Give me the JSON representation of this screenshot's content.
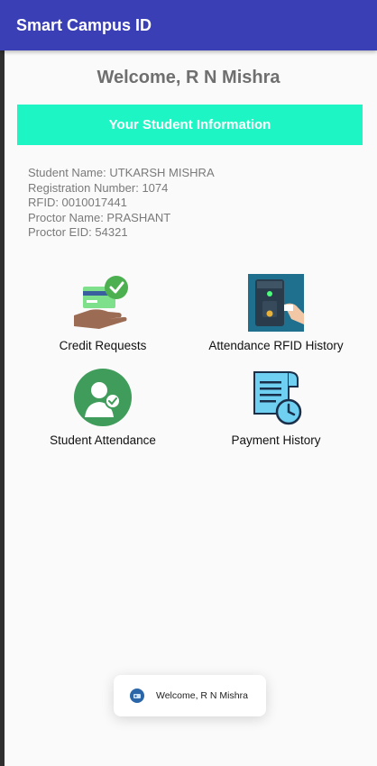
{
  "app": {
    "title": "Smart Campus ID"
  },
  "welcome": "Welcome, R N Mishra",
  "info_banner": "Your Student Information",
  "student": {
    "name_line": "Student Name: UTKARSH MISHRA",
    "registration_line": "Registration Number: 1074",
    "rfid_line": "RFID: 0010017441",
    "proctor_line": "Proctor Name: PRASHANT",
    "proctor_eid_line": "Proctor EID: 54321"
  },
  "tiles": [
    {
      "label": "Credit Requests",
      "icon": "credit-card-check-icon"
    },
    {
      "label": "Attendance RFID History",
      "icon": "rfid-reader-icon"
    },
    {
      "label": "Student Attendance",
      "icon": "student-check-icon"
    },
    {
      "label": "Payment History",
      "icon": "receipt-clock-icon"
    }
  ],
  "toast": {
    "text": "Welcome, R N Mishra",
    "icon": "app-icon"
  },
  "colors": {
    "appbar": "#3b3fb6",
    "banner": "#1ef5c5",
    "check_green": "#4caf50"
  }
}
